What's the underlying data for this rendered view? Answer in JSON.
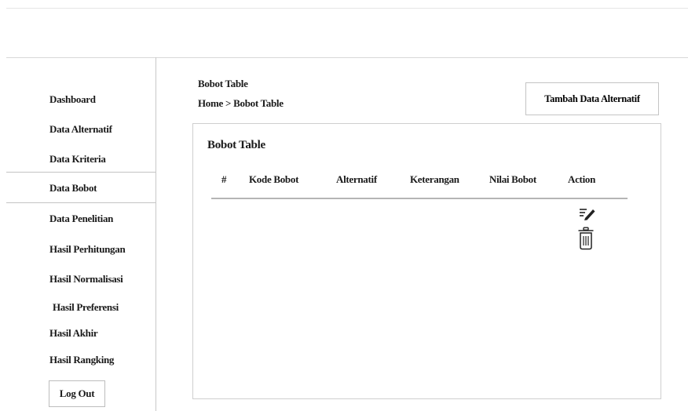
{
  "sidebar": {
    "items": [
      {
        "label": "Dashboard"
      },
      {
        "label": "Data Alternatif"
      },
      {
        "label": "Data Kriteria"
      },
      {
        "label": "Data Bobot"
      },
      {
        "label": "Data Penelitian"
      },
      {
        "label": "Hasil Perhitungan"
      },
      {
        "label": "Hasil Normalisasi"
      },
      {
        "label": "Hasil  Preferensi"
      },
      {
        "label": "Hasil Akhir"
      },
      {
        "label": "Hasil Rangking"
      }
    ],
    "logout_label": "Log Out",
    "active_item": "Data Bobot"
  },
  "header": {
    "title": "Bobot Table",
    "breadcrumb": {
      "home": "Home",
      "separator": ">",
      "current": "Bobot Table"
    },
    "add_button_label": "Tambah Data Alternatif"
  },
  "card": {
    "title": "Bobot Table",
    "columns": [
      "#",
      "Kode Bobot",
      "Alternatif",
      "Keterangan",
      "Nilai Bobot",
      "Action"
    ],
    "row_actions": [
      {
        "icon": "edit-icon"
      },
      {
        "icon": "trash-icon"
      }
    ]
  }
}
